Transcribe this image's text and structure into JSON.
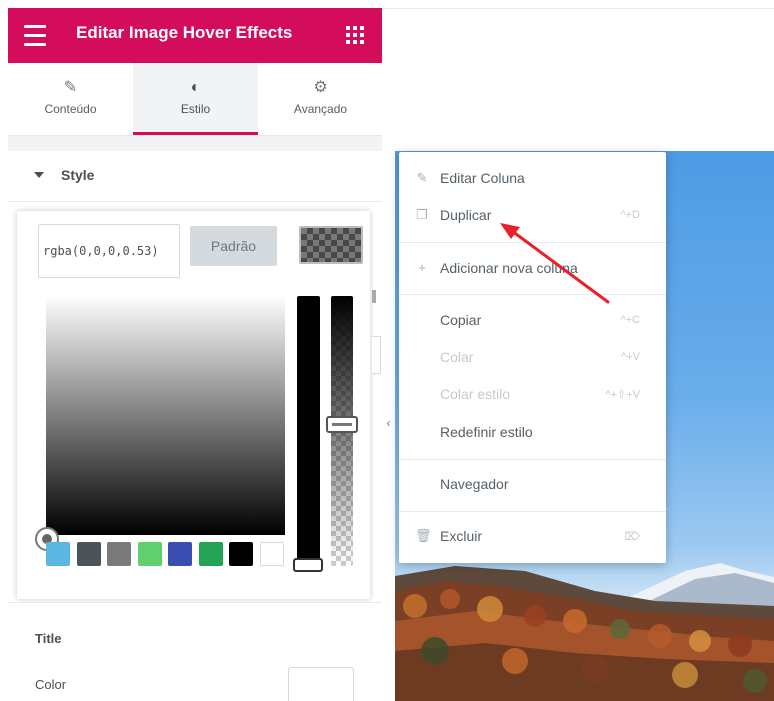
{
  "panel": {
    "header_title": "Editar Image Hover Effects",
    "tabs": [
      {
        "label": "Conteúdo",
        "icon": "pencil-icon"
      },
      {
        "label": "Estilo",
        "icon": "half-circle-icon"
      },
      {
        "label": "Avançado",
        "icon": "gear-icon"
      }
    ],
    "active_tab": "Estilo",
    "section_title": "Style",
    "accent_color": "#d30c5c"
  },
  "color_picker": {
    "value": "rgba(0,0,0,0.53)",
    "clear_label": "Padrão",
    "swatches": [
      "#5bb6e4",
      "#4d5459",
      "#7a7a7a",
      "#61ce70",
      "#3a4db0",
      "#23a455",
      "#000000",
      "#ffffff"
    ]
  },
  "title_section": {
    "heading": "Title",
    "color_label": "Color"
  },
  "context_menu": {
    "items": [
      {
        "label": "Editar Coluna",
        "icon": "pencil-icon",
        "shortcut": ""
      },
      {
        "label": "Duplicar",
        "icon": "copy-icon",
        "shortcut": "^+D"
      },
      {
        "label": "Adicionar nova coluna",
        "icon": "plus-icon",
        "shortcut": ""
      },
      {
        "label": "Copiar",
        "shortcut": "^+C"
      },
      {
        "label": "Colar",
        "shortcut": "^+V",
        "disabled": true
      },
      {
        "label": "Colar estilo",
        "shortcut": "^+⇧+V",
        "disabled": true
      },
      {
        "label": "Redefinir estilo",
        "shortcut": ""
      },
      {
        "label": "Navegador",
        "shortcut": ""
      },
      {
        "label": "Excluir",
        "icon": "trash-icon",
        "shortcut": "⌦"
      }
    ]
  }
}
